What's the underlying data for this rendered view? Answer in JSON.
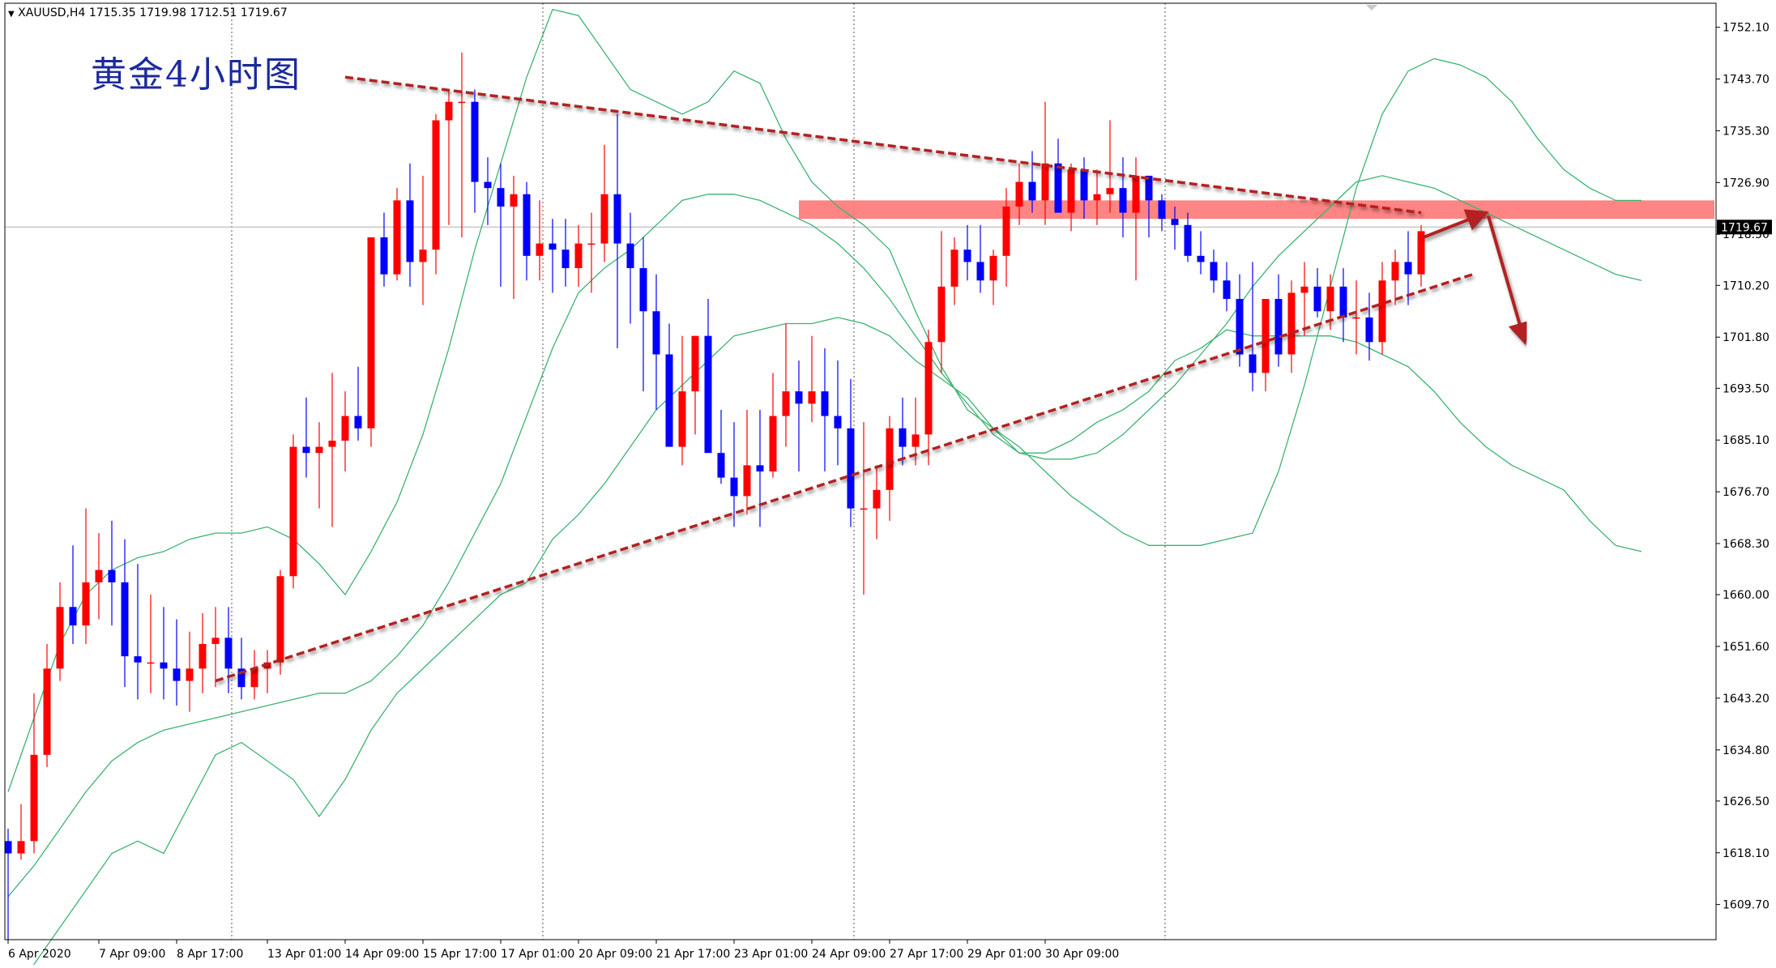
{
  "symbol_line": "XAUUSD,H4  1715.35 1719.98 1712.51 1719.67",
  "chart_title": "黄金4小时图",
  "current_price_label": "1719.67",
  "colors": {
    "bull": "#ff0000",
    "bear": "#0000ff",
    "bollinger": "#3cb371",
    "trendline": "#b22222",
    "resistance_zone": "#ff6f6f",
    "grid_vertical": "#555555"
  },
  "chart_data": {
    "type": "candlestick",
    "title": "黄金4小时图",
    "symbol": "XAUUSD",
    "timeframe": "H4",
    "ylim": [
      1604,
      1756
    ],
    "y_ticks": [
      "1752.10",
      "1743.70",
      "1735.30",
      "1726.90",
      "1718.50",
      "1710.20",
      "1701.80",
      "1693.50",
      "1685.10",
      "1676.70",
      "1668.30",
      "1660.00",
      "1651.60",
      "1643.20",
      "1634.80",
      "1626.50",
      "1618.10",
      "1609.70"
    ],
    "x_ticks": [
      {
        "index": 0,
        "label": "6 Apr 2020"
      },
      {
        "index": 7,
        "label": "7 Apr 09:00"
      },
      {
        "index": 13,
        "label": "8 Apr 17:00"
      },
      {
        "index": 20,
        "label": "13 Apr 01:00"
      },
      {
        "index": 26,
        "label": "14 Apr 09:00"
      },
      {
        "index": 32,
        "label": "15 Apr 17:00"
      },
      {
        "index": 38,
        "label": "17 Apr 01:00"
      },
      {
        "index": 44,
        "label": "20 Apr 09:00"
      },
      {
        "index": 50,
        "label": "21 Apr 17:00"
      },
      {
        "index": 56,
        "label": "23 Apr 01:00"
      },
      {
        "index": 62,
        "label": "24 Apr 09:00"
      },
      {
        "index": 68,
        "label": "27 Apr 17:00"
      },
      {
        "index": 74,
        "label": "29 Apr 01:00"
      },
      {
        "index": 80,
        "label": "30 Apr 09:00"
      }
    ],
    "separator_indices": [
      17,
      41,
      65,
      89
    ],
    "candles": [
      [
        1620,
        1622,
        1604,
        1618
      ],
      [
        1618,
        1626,
        1617,
        1620
      ],
      [
        1620,
        1644,
        1618,
        1634
      ],
      [
        1634,
        1652,
        1632,
        1648
      ],
      [
        1648,
        1662,
        1646,
        1658
      ],
      [
        1658,
        1668,
        1652,
        1655
      ],
      [
        1655,
        1674,
        1652,
        1662
      ],
      [
        1662,
        1670,
        1656,
        1664
      ],
      [
        1664,
        1672,
        1655,
        1662
      ],
      [
        1662,
        1669,
        1645,
        1650
      ],
      [
        1650,
        1665,
        1643,
        1649
      ],
      [
        1649,
        1660,
        1644,
        1649
      ],
      [
        1649,
        1658,
        1643,
        1648
      ],
      [
        1648,
        1656,
        1642,
        1646
      ],
      [
        1646,
        1654,
        1641,
        1648
      ],
      [
        1648,
        1657,
        1644,
        1652
      ],
      [
        1652,
        1658,
        1645,
        1653
      ],
      [
        1653,
        1658,
        1644,
        1648
      ],
      [
        1648,
        1653,
        1643,
        1645
      ],
      [
        1645,
        1651,
        1643,
        1648
      ],
      [
        1648,
        1651,
        1644,
        1649
      ],
      [
        1649,
        1664,
        1647,
        1663
      ],
      [
        1663,
        1686,
        1661,
        1684
      ],
      [
        1684,
        1692,
        1679,
        1683
      ],
      [
        1683,
        1688,
        1674,
        1684
      ],
      [
        1684,
        1696,
        1671,
        1685
      ],
      [
        1685,
        1693,
        1680,
        1689
      ],
      [
        1689,
        1697,
        1685,
        1687
      ],
      [
        1687,
        1718,
        1684,
        1718
      ],
      [
        1718,
        1722,
        1710,
        1712
      ],
      [
        1712,
        1726,
        1711,
        1724
      ],
      [
        1724,
        1730,
        1710,
        1714
      ],
      [
        1714,
        1728,
        1707,
        1716
      ],
      [
        1716,
        1738,
        1712,
        1737
      ],
      [
        1737,
        1742,
        1720,
        1740
      ],
      [
        1740,
        1748,
        1718,
        1740
      ],
      [
        1740,
        1742,
        1722,
        1727
      ],
      [
        1727,
        1731,
        1720,
        1726
      ],
      [
        1726,
        1730,
        1710,
        1723
      ],
      [
        1723,
        1728,
        1708,
        1725
      ],
      [
        1725,
        1727,
        1711,
        1715
      ],
      [
        1715,
        1724,
        1711,
        1717
      ],
      [
        1717,
        1721,
        1709,
        1716
      ],
      [
        1716,
        1721,
        1710,
        1713
      ],
      [
        1713,
        1720,
        1710,
        1717
      ],
      [
        1717,
        1722,
        1709,
        1717
      ],
      [
        1717,
        1733,
        1714,
        1725
      ],
      [
        1725,
        1738,
        1700,
        1717
      ],
      [
        1717,
        1722,
        1704,
        1713
      ],
      [
        1713,
        1718,
        1693,
        1706
      ],
      [
        1706,
        1712,
        1690,
        1699
      ],
      [
        1699,
        1704,
        1686,
        1684
      ],
      [
        1684,
        1702,
        1681,
        1693
      ],
      [
        1693,
        1702,
        1686,
        1702
      ],
      [
        1702,
        1708,
        1690,
        1683
      ],
      [
        1683,
        1690,
        1678,
        1679
      ],
      [
        1679,
        1688,
        1671,
        1676
      ],
      [
        1676,
        1690,
        1673,
        1681
      ],
      [
        1681,
        1690,
        1671,
        1680
      ],
      [
        1680,
        1696,
        1679,
        1689
      ],
      [
        1689,
        1704,
        1684,
        1693
      ],
      [
        1693,
        1698,
        1680,
        1691
      ],
      [
        1691,
        1702,
        1688,
        1693
      ],
      [
        1693,
        1700,
        1680,
        1689
      ],
      [
        1689,
        1698,
        1681,
        1687
      ],
      [
        1687,
        1695,
        1671,
        1674
      ],
      [
        1674,
        1688,
        1660,
        1674
      ],
      [
        1674,
        1681,
        1669,
        1677
      ],
      [
        1677,
        1689,
        1672,
        1687
      ],
      [
        1687,
        1692,
        1681,
        1684
      ],
      [
        1684,
        1692,
        1681,
        1686
      ],
      [
        1686,
        1703,
        1681,
        1701
      ],
      [
        1701,
        1719,
        1696,
        1710
      ],
      [
        1710,
        1718,
        1707,
        1716
      ],
      [
        1716,
        1720,
        1711,
        1714
      ],
      [
        1714,
        1720,
        1709,
        1711
      ],
      [
        1711,
        1716,
        1707,
        1715
      ],
      [
        1715,
        1726,
        1710,
        1723
      ],
      [
        1723,
        1730,
        1720,
        1727
      ],
      [
        1727,
        1732,
        1722,
        1724
      ],
      [
        1724,
        1740,
        1720,
        1730
      ],
      [
        1730,
        1734,
        1722,
        1722
      ],
      [
        1722,
        1730,
        1719,
        1729
      ],
      [
        1729,
        1731,
        1721,
        1724
      ],
      [
        1724,
        1729,
        1720,
        1725
      ],
      [
        1725,
        1737,
        1722,
        1726
      ],
      [
        1726,
        1731,
        1718,
        1722
      ],
      [
        1722,
        1731,
        1711,
        1728
      ],
      [
        1728,
        1728,
        1718,
        1724
      ],
      [
        1724,
        1725,
        1719,
        1721
      ],
      [
        1721,
        1723,
        1716,
        1720
      ],
      [
        1720,
        1722,
        1714,
        1715
      ],
      [
        1715,
        1719,
        1712,
        1714
      ],
      [
        1714,
        1716,
        1709,
        1711
      ],
      [
        1711,
        1714,
        1706,
        1708
      ],
      [
        1708,
        1712,
        1697,
        1699
      ],
      [
        1699,
        1714,
        1693,
        1696
      ],
      [
        1696,
        1707,
        1693,
        1708
      ],
      [
        1708,
        1712,
        1697,
        1699
      ],
      [
        1699,
        1711,
        1696,
        1709
      ],
      [
        1709,
        1714,
        1702,
        1710
      ],
      [
        1710,
        1713,
        1705,
        1706
      ],
      [
        1706,
        1712,
        1703,
        1710
      ],
      [
        1710,
        1713,
        1701,
        1705
      ],
      [
        1705,
        1711,
        1699,
        1705
      ],
      [
        1705,
        1709,
        1698,
        1701
      ],
      [
        1701,
        1714,
        1699,
        1711
      ],
      [
        1711,
        1716,
        1707,
        1714
      ],
      [
        1714,
        1719,
        1707,
        1712
      ],
      [
        1712,
        1720,
        1710,
        1719
      ]
    ],
    "bollinger_upper": [
      1628,
      1640,
      1652,
      1660,
      1664,
      1666,
      1667,
      1669,
      1670,
      1670,
      1671,
      1669,
      1665,
      1660,
      1667,
      1675,
      1686,
      1700,
      1716,
      1730,
      1744,
      1755,
      1754,
      1748,
      1742,
      1740,
      1738,
      1740,
      1745,
      1743,
      1734,
      1727,
      1723,
      1720,
      1716,
      1706,
      1697,
      1690,
      1687,
      1684,
      1680,
      1676,
      1673,
      1670,
      1668,
      1668,
      1668,
      1669,
      1670,
      1680,
      1694,
      1710,
      1726,
      1738,
      1745,
      1747,
      1746,
      1744,
      1740,
      1734,
      1729,
      1726,
      1724,
      1724
    ],
    "bollinger_mid": [
      1611,
      1616,
      1622,
      1628,
      1633,
      1636,
      1638,
      1639,
      1640,
      1641,
      1642,
      1643,
      1644,
      1644,
      1646,
      1650,
      1655,
      1662,
      1670,
      1678,
      1689,
      1700,
      1709,
      1713,
      1716,
      1720,
      1724,
      1725,
      1725,
      1724,
      1722,
      1720,
      1717,
      1713,
      1708,
      1702,
      1696,
      1691,
      1686,
      1683,
      1682,
      1682,
      1683,
      1686,
      1690,
      1694,
      1699,
      1704,
      1710,
      1715,
      1719,
      1723,
      1727,
      1728,
      1727,
      1726,
      1724,
      1722,
      1720,
      1718,
      1716,
      1714,
      1712,
      1711
    ],
    "bollinger_lower": [
      1594,
      1600,
      1606,
      1612,
      1618,
      1620,
      1618,
      1626,
      1634,
      1636,
      1633,
      1630,
      1624,
      1630,
      1638,
      1644,
      1648,
      1652,
      1656,
      1660,
      1662,
      1669,
      1673,
      1678,
      1684,
      1690,
      1694,
      1698,
      1702,
      1703,
      1704,
      1704,
      1705,
      1704,
      1702,
      1698,
      1695,
      1692,
      1687,
      1683,
      1683,
      1685,
      1688,
      1690,
      1693,
      1698,
      1700,
      1703,
      1702,
      1702,
      1702,
      1702,
      1701,
      1699,
      1697,
      1693,
      1688,
      1684,
      1681,
      1679,
      1677,
      1672,
      1668,
      1667
    ],
    "trendlines": [
      {
        "from": [
          26,
          1744
        ],
        "to": [
          109,
          1722
        ]
      },
      {
        "from": [
          16,
          1646
        ],
        "to": [
          113,
          1712
        ]
      }
    ],
    "resistance_zone": {
      "from_index": 61,
      "to_index": 116,
      "low": 1721,
      "high": 1724
    },
    "current_price": 1719.67
  }
}
